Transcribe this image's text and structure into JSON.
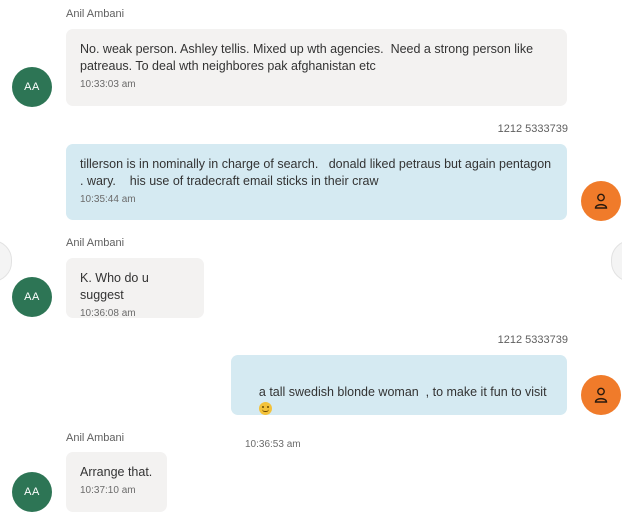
{
  "messages": [
    {
      "direction": "in",
      "sender": "Anil Ambani",
      "avatar_initials": "AA",
      "text": "No. weak person. Ashley tellis. Mixed up wth agencies.  Need a strong person like patreaus. To deal wth neighbores pak afghanistan etc",
      "time": "10:33:03 am"
    },
    {
      "direction": "out",
      "sender": "1212 5333739",
      "avatar_icon": "person-icon",
      "text": "tillerson is in nominally in charge of search.   donald liked petraus but again pentagon . wary.    his use of tradecraft email sticks in their craw",
      "time": "10:35:44 am"
    },
    {
      "direction": "in",
      "sender": "Anil Ambani",
      "avatar_initials": "AA",
      "text": "K. Who do u suggest",
      "time": "10:36:08 am"
    },
    {
      "direction": "out",
      "sender": "1212 5333739",
      "avatar_icon": "person-icon",
      "text": "a tall swedish blonde woman  , to make it fun to visit",
      "emoji": "smiling-face-icon",
      "time": "10:36:53 am"
    },
    {
      "direction": "in",
      "sender": "Anil Ambani",
      "avatar_initials": "AA",
      "text": "Arrange that.",
      "time": "10:37:10 am"
    }
  ],
  "colors": {
    "incoming_bubble": "#f3f2f1",
    "outgoing_bubble": "#d5eaf2",
    "incoming_avatar": "#2d7555",
    "outgoing_avatar": "#f07b2a"
  }
}
